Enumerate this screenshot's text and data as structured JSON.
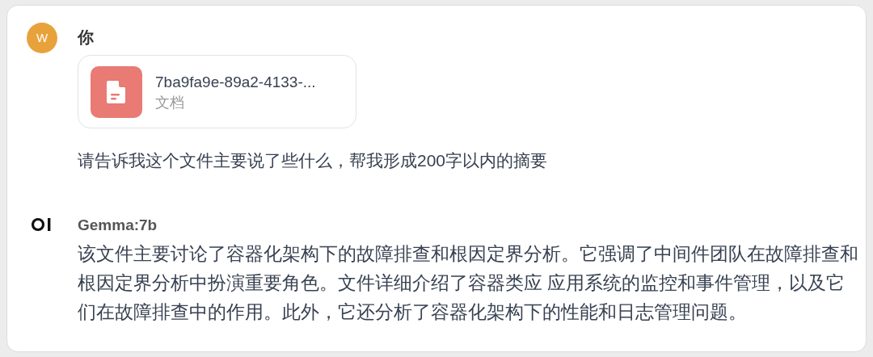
{
  "messages": [
    {
      "kind": "user",
      "avatar": "W",
      "author": "你",
      "attachments": [
        {
          "name": "7ba9fa9e-89a2-4133-...",
          "type": "文档"
        }
      ],
      "text": "请告诉我这个文件主要说了些什么，帮我形成200字以内的摘要"
    },
    {
      "kind": "assistant",
      "author": "Gemma:7b",
      "text": "该文件主要讨论了容器化架构下的故障排查和根因定界分析。它强调了中间件团队在故障排查和根因定界分析中扮演重要角色。文件详细介绍了容器类应 应用系统的监控和事件管理，以及它们在故障排查中的作用。此外，它还分析了容器化架构下的性能和日志管理问题。"
    }
  ]
}
